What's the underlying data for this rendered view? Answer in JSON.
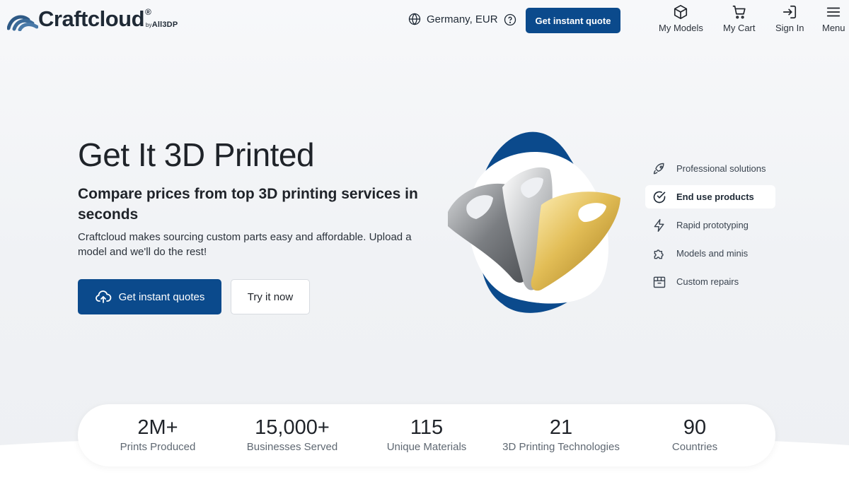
{
  "header": {
    "logo_text": "Craftcloud",
    "logo_reg": "®",
    "logo_by": "by",
    "logo_partner": "All3DP",
    "region": "Germany, EUR",
    "quote_button": "Get instant quote",
    "nav": [
      {
        "label": "My Models",
        "icon": "cube-icon"
      },
      {
        "label": "My Cart",
        "icon": "cart-icon"
      },
      {
        "label": "Sign In",
        "icon": "sign-in-icon"
      },
      {
        "label": "Menu",
        "icon": "hamburger-icon"
      }
    ]
  },
  "hero": {
    "title": "Get It 3D Printed",
    "subtitle": "Compare prices from top 3D printing services in seconds",
    "body": "Craftcloud makes sourcing custom parts easy and affordable. Upload a model and we'll do the rest!",
    "primary_button": "Get instant quotes",
    "secondary_button": "Try it now"
  },
  "usecases": [
    {
      "label": "Professional solutions",
      "icon": "rocket-icon",
      "active": false
    },
    {
      "label": "End use products",
      "icon": "check-circle-icon",
      "active": true
    },
    {
      "label": "Rapid prototyping",
      "icon": "lightning-icon",
      "active": false
    },
    {
      "label": "Models and minis",
      "icon": "puzzle-icon",
      "active": false
    },
    {
      "label": "Custom repairs",
      "icon": "toolbox-icon",
      "active": false
    }
  ],
  "stats": [
    {
      "value": "2M+",
      "label": "Prints Produced"
    },
    {
      "value": "15,000+",
      "label": "Businesses Served"
    },
    {
      "value": "115",
      "label": "Unique Materials"
    },
    {
      "value": "21",
      "label": "3D Printing Technologies"
    },
    {
      "value": "90",
      "label": "Countries"
    }
  ],
  "colors": {
    "brand_blue": "#0b4a8c",
    "text_dark": "#1f2329",
    "silver": "#a9abad",
    "gold": "#d9b24a"
  }
}
